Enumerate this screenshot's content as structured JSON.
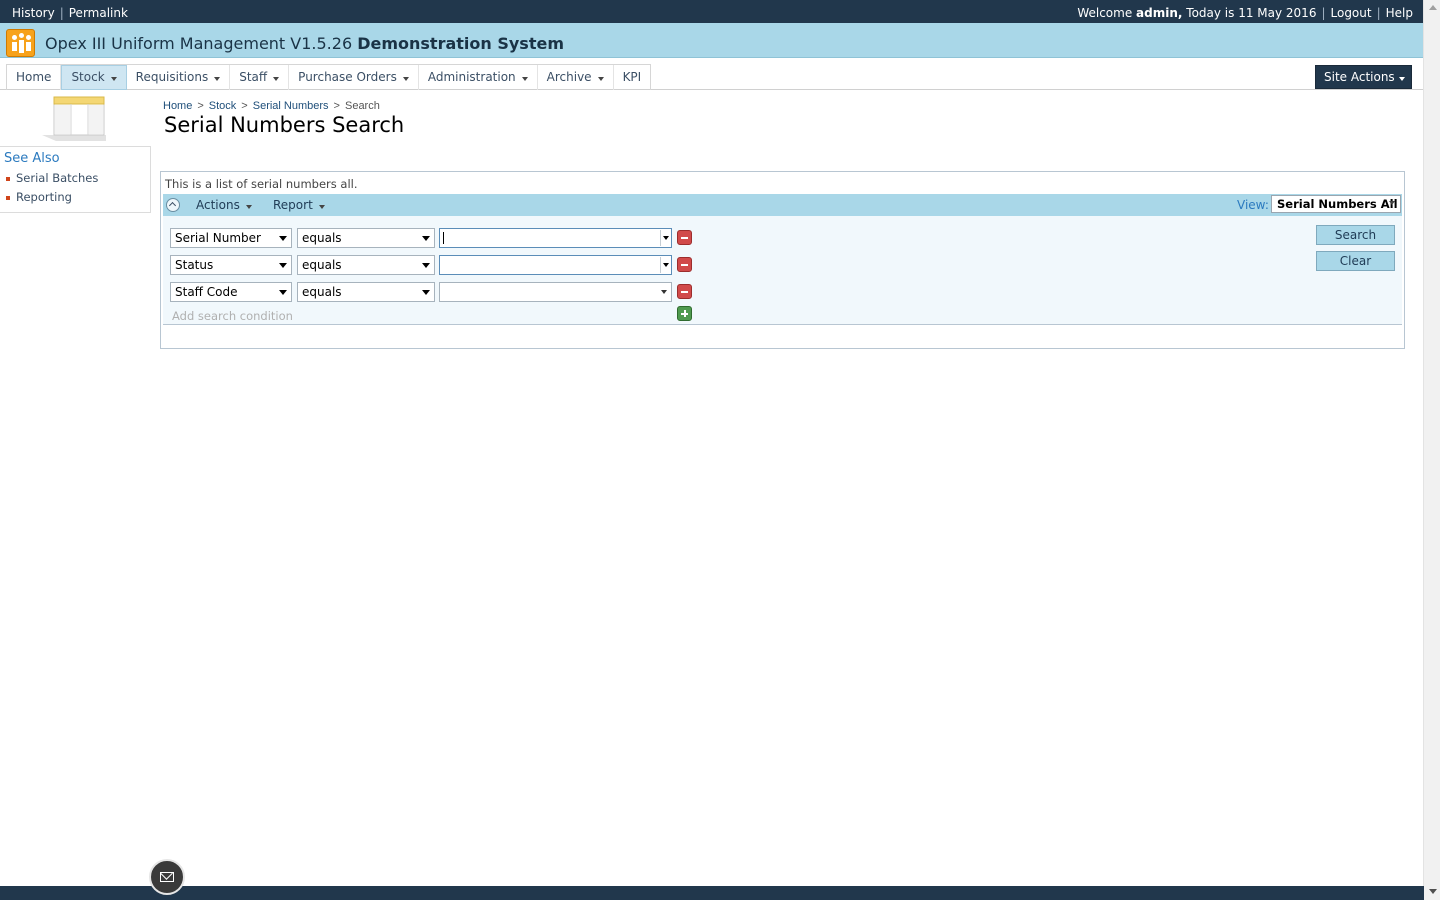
{
  "topbar": {
    "history": "History",
    "permalink": "Permalink",
    "welcome": "Welcome",
    "user": "admin,",
    "today": "Today is 11 May 2016",
    "logout": "Logout",
    "help": "Help"
  },
  "app": {
    "title": "Opex III Uniform Management V1.5.26",
    "system": "Demonstration System",
    "accent_color": "#a9d7e8",
    "dark_color": "#21374c"
  },
  "nav": {
    "items": [
      {
        "label": "Home"
      },
      {
        "label": "Stock"
      },
      {
        "label": "Requisitions"
      },
      {
        "label": "Staff"
      },
      {
        "label": "Purchase Orders"
      },
      {
        "label": "Administration"
      },
      {
        "label": "Archive"
      },
      {
        "label": "KPI"
      }
    ],
    "active": "Stock",
    "site_actions": "Site Actions"
  },
  "see_also": {
    "title": "See Also",
    "items": [
      "Serial Batches",
      "Reporting"
    ]
  },
  "breadcrumb": [
    "Home",
    "Stock",
    "Serial Numbers",
    "Search"
  ],
  "page_title": "Serial Numbers Search",
  "panel": {
    "description": "This is a list of serial numbers all.",
    "actions": "Actions",
    "report": "Report",
    "view_label": "View:",
    "view_value": "Serial Numbers All"
  },
  "conditions": [
    {
      "field": "Serial Number",
      "operator": "equals",
      "value": ""
    },
    {
      "field": "Status",
      "operator": "equals",
      "value": ""
    },
    {
      "field": "Staff Code",
      "operator": "equals",
      "value": ""
    }
  ],
  "add_condition": "Add search condition",
  "buttons": {
    "search": "Search",
    "clear": "Clear"
  }
}
